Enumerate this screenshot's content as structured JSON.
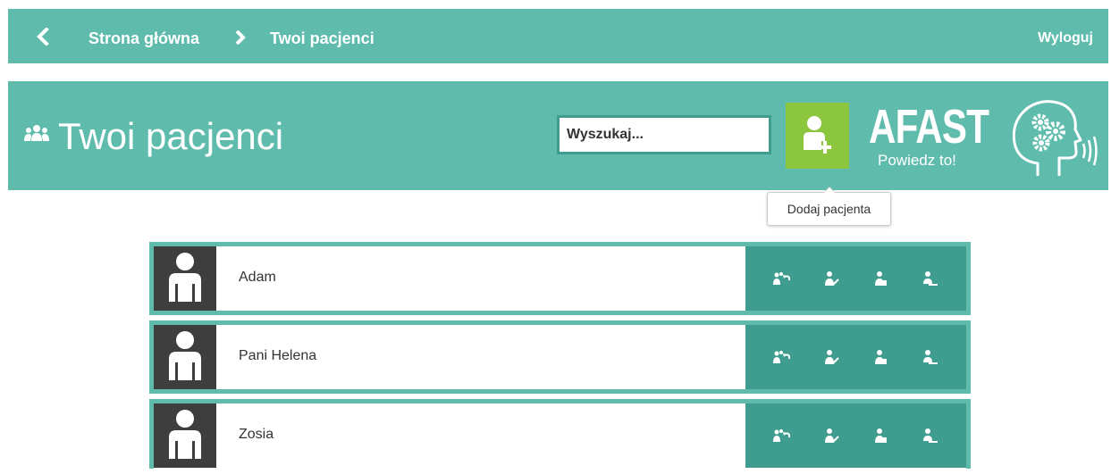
{
  "nav": {
    "back_icon": "chevron-left-icon",
    "crumbs": [
      "Strona główna",
      "Twoi pacjenci"
    ],
    "logout": "Wyloguj"
  },
  "header": {
    "icon": "people-icon",
    "title": "Twoi pacjenci",
    "search_placeholder": "Wyszukaj...",
    "add_button_icon": "add-user-icon",
    "tooltip": "Dodaj pacjenta"
  },
  "logo": {
    "name": "AFAST",
    "tagline": "Powiedz to!"
  },
  "patients": [
    {
      "name": "Adam"
    },
    {
      "name": "Pani Helena"
    },
    {
      "name": "Zosia"
    }
  ],
  "colors": {
    "teal": "#5fbcad",
    "teal_dark": "#3f9d8f",
    "green": "#8cc63f",
    "avatar_bg": "#3e3e3e"
  }
}
